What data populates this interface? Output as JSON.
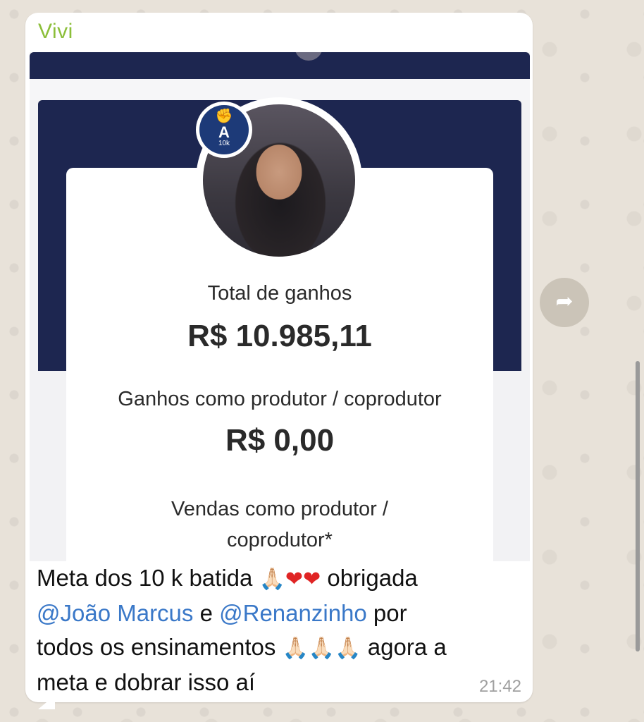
{
  "message": {
    "sender": "Vivi",
    "time": "21:42",
    "text_parts": {
      "p1": "Meta dos 10 k batida ",
      "p2": " obrigada",
      "mention1": "@João Marcus",
      "p3": " e ",
      "mention2": "@Renanzinho",
      "p4": "  por",
      "p5": "todos os ensinamentos ",
      "p6": " agora a",
      "p7": "meta e dobrar isso aí"
    },
    "emoji": {
      "hands": "🙏🏻",
      "heart": "❤",
      "hands3": "🙏🏻🙏🏻🙏🏻"
    }
  },
  "screenshot": {
    "badge": {
      "letter": "A",
      "sub": "10k",
      "icon": "fist-icon"
    },
    "total_label": "Total de ganhos",
    "total_value": "R$ 10.985,11",
    "prod_label": "Ganhos como produtor / coprodutor",
    "prod_value": "R$ 0,00",
    "sales_label_line1": "Vendas como produtor /",
    "sales_label_line2": "coprodutor*"
  },
  "controls": {
    "forward_icon": "forward-arrow-icon"
  },
  "colors": {
    "sender": "#8cbf3a",
    "mention": "#3a78c8",
    "card_header": "#1d2650",
    "bubble": "#ffffff",
    "wallpaper": "#e8e2d9"
  }
}
